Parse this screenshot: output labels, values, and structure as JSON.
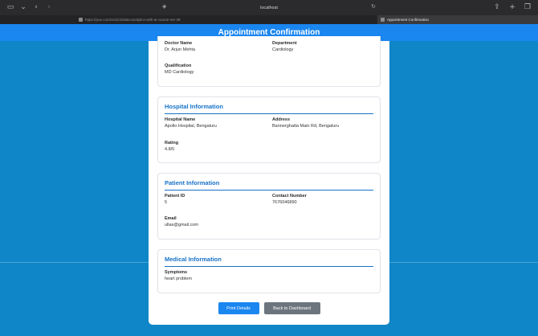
{
  "browser": {
    "host": "localhost",
    "tabs": [
      {
        "label": "https://poe.com/onclick/data-analytics-with-ai-course-ver-39"
      },
      {
        "label": "Appointment Confirmation"
      }
    ]
  },
  "header": {
    "title": "Appointment Confirmation"
  },
  "doctor": {
    "fields": [
      {
        "label": "Doctor Name",
        "value": "Dr. Arjun Mehta"
      },
      {
        "label": "Department",
        "value": "Cardiology"
      },
      {
        "label": "Qualification",
        "value": "MD Cardiology"
      }
    ]
  },
  "hospital": {
    "title": "Hospital Information",
    "fields": [
      {
        "label": "Hospital Name",
        "value": "Apollo Hospital, Bengaluru"
      },
      {
        "label": "Address",
        "value": "Bannerghatta Main Rd, Bengaluru"
      },
      {
        "label": "Rating",
        "value": "4.8/5"
      }
    ]
  },
  "patient": {
    "title": "Patient Information",
    "fields": [
      {
        "label": "Patient ID",
        "value": "5"
      },
      {
        "label": "Contact Number",
        "value": "7676046890"
      },
      {
        "label": "Email",
        "value": "ullas@gmail.com"
      }
    ]
  },
  "medical": {
    "title": "Medical Information",
    "fields": [
      {
        "label": "Symptoms",
        "value": "heart problem"
      }
    ]
  },
  "actions": {
    "print": "Print Details",
    "back": "Back to Dashboard"
  }
}
